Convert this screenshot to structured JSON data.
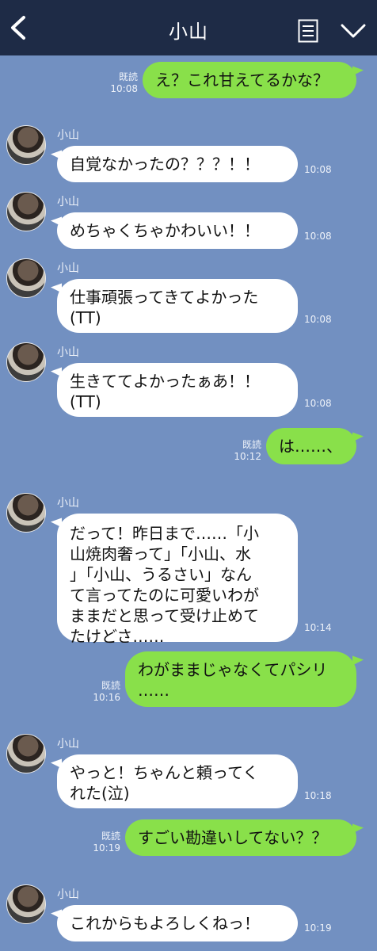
{
  "header": {
    "title": "小山",
    "back_icon": "chevron-left-icon",
    "notes_icon": "notes-icon",
    "menu_icon": "chevron-down-icon",
    "bg_color": "#1e2b46"
  },
  "chat": {
    "bg_color": "#7290c1",
    "out_bubble_color": "#89e04a",
    "in_bubble_color": "#ffffff",
    "messages": [
      {
        "dir": "out",
        "text": "え？これ甘えてるかな？",
        "read": "既読",
        "time": "10:08"
      },
      {
        "dir": "in",
        "name": "小山",
        "text": "自覚なかったの？？？！！",
        "time": "10:08"
      },
      {
        "dir": "in",
        "name": "小山",
        "text": "めちゃくちゃかわいい！！",
        "time": "10:08"
      },
      {
        "dir": "in",
        "name": "小山",
        "text": "仕事頑張ってきてよかった\n(TT)",
        "time": "10:08"
      },
      {
        "dir": "in",
        "name": "小山",
        "text": "生きててよかったぁあ！！\n(TT)",
        "time": "10:08"
      },
      {
        "dir": "out",
        "text": "は……、",
        "read": "既読",
        "time": "10:12"
      },
      {
        "dir": "in",
        "name": "小山",
        "text": "だって！昨日まで……「小\n山焼肉奢って」「小山、水\n」「小山、うるさい」なん\nて言ってたのに可愛いわが\nままだと思って受け止めて\nたけどさ……",
        "time": "10:14"
      },
      {
        "dir": "out",
        "text": "わがままじゃなくてパシリ\n……",
        "read": "既読",
        "time": "10:16"
      },
      {
        "dir": "in",
        "name": "小山",
        "text": "やっと！ちゃんと頼ってく\nれた(泣)",
        "time": "10:18"
      },
      {
        "dir": "out",
        "text": "すごい勘違いしてない？？",
        "read": "既読",
        "time": "10:19"
      },
      {
        "dir": "in",
        "name": "小山",
        "text": "これからもよろしくねっ！",
        "time": "10:19"
      }
    ]
  }
}
